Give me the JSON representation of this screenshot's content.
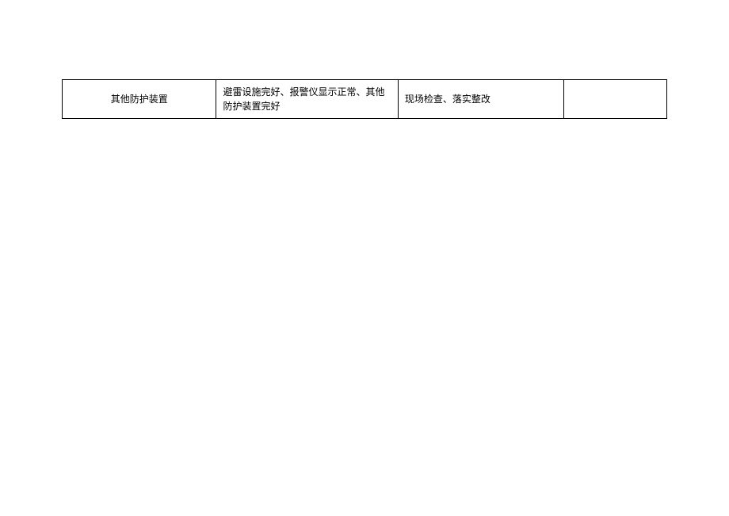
{
  "table": {
    "rows": [
      {
        "col1": "其他防护装置",
        "col2": "避雷设施完好、报警仪显示正常、其他防护装置完好",
        "col3": "现场检查、落实整改",
        "col4": ""
      }
    ]
  }
}
